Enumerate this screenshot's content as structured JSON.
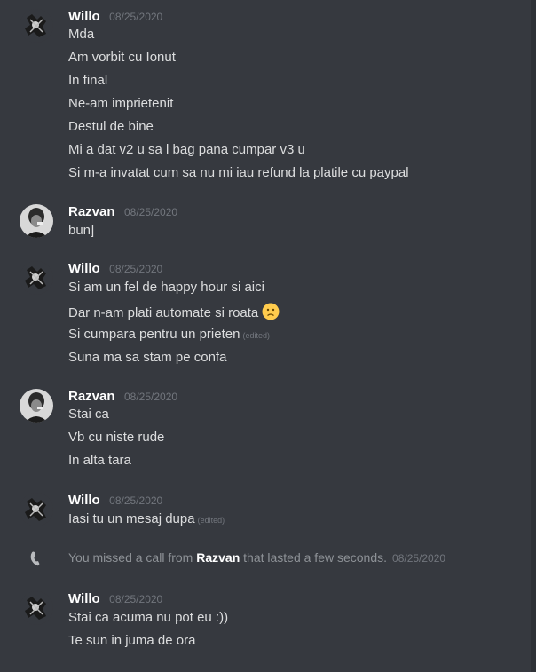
{
  "messages": [
    {
      "author": "Willo",
      "time": "08/25/2020",
      "lines": [
        "Mda",
        "Am vorbit cu Ionut",
        "In final",
        "Ne-am imprietenit",
        "Destul de bine",
        "Mi a dat v2 u sa l bag pana cumpar v3 u",
        "Si m-a invatat cum sa nu mi iau refund la platile cu paypal"
      ]
    },
    {
      "author": "Razvan",
      "time": "08/25/2020",
      "lines": [
        "bun]"
      ]
    },
    {
      "author": "Willo",
      "time": "08/25/2020",
      "lines": [
        "Si am un fel de happy hour si aici",
        "Dar n-am plati automate si roata",
        "Si cumpara pentru un prieten",
        "Suna ma sa stam pe confa"
      ],
      "edited_label": "(edited)",
      "emoji": "slightly-frowning-face"
    },
    {
      "author": "Razvan",
      "time": "08/25/2020",
      "lines": [
        "Stai ca",
        "Vb cu niste rude",
        "In alta tara"
      ]
    },
    {
      "author": "Willo",
      "time": "08/25/2020",
      "lines": [
        "Iasi tu un mesaj dupa"
      ],
      "edited_label": "(edited)"
    },
    {
      "author": "Willo",
      "time": "08/25/2020",
      "lines": [
        "Stai ca acuma nu pot eu :))",
        "Te sun in juma de ora"
      ]
    }
  ],
  "missed_call": {
    "prefix": "You missed a call from ",
    "caller": "Razvan",
    "suffix": " that lasted a few seconds.",
    "time": "08/25/2020",
    "icon": "phone-icon"
  },
  "colors": {
    "background": "#36393f",
    "username": "#ffffff",
    "text": "#dcddde",
    "muted": "#72767d"
  }
}
